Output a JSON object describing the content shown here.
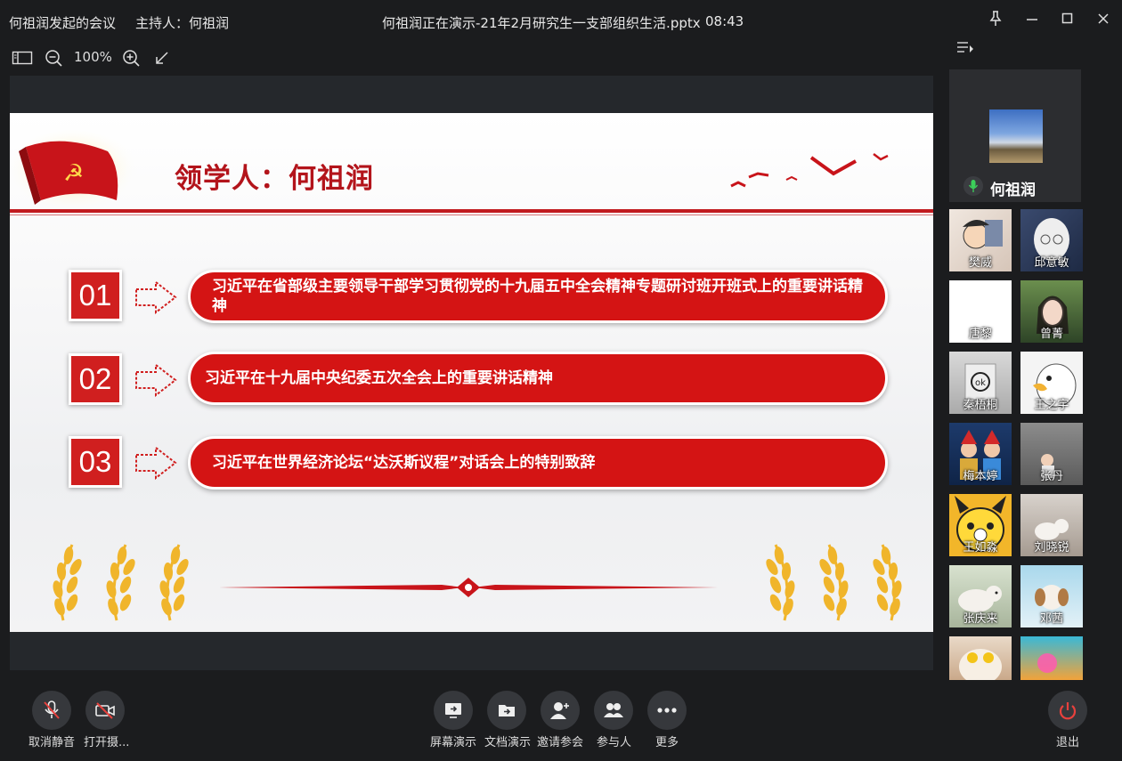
{
  "titlebar": {
    "meeting": "何祖润发起的会议",
    "host": "主持人：何祖润",
    "presenting": "何祖润正在演示-21年2月研究生一支部组织生活.pptx",
    "time": "08:43"
  },
  "toolbar": {
    "zoom": "100%"
  },
  "slide": {
    "title": "领学人：何祖润",
    "items": [
      {
        "num": "01",
        "text": "习近平在省部级主要领导干部学习贯彻党的十九届五中全会精神专题研讨班开班式上的重要讲话精神"
      },
      {
        "num": "02",
        "text": "习近平在十九届中央纪委五次全会上的重要讲话精神"
      },
      {
        "num": "03",
        "text": "习近平在世界经济论坛“达沃斯议程”对话会上的特别致辞"
      }
    ]
  },
  "sidebar": {
    "host_name": "何祖润",
    "participants": [
      "樊威",
      "邱意敏",
      "唐黎",
      "曾菁",
      "秦梧桐",
      "王之宇",
      "梅本婷",
      "张丹",
      "王如淼",
      "刘晓锐",
      "张庆来",
      "邓茜",
      "",
      ""
    ]
  },
  "bottombar": {
    "mute": "取消静音",
    "camera": "打开摄...",
    "screen_share": "屏幕演示",
    "doc_share": "文档演示",
    "invite": "邀请参会",
    "participants": "参与人",
    "more": "更多",
    "exit": "退出"
  },
  "colors": {
    "accent_red": "#d41414",
    "exit_red": "#e8413d",
    "background": "#1b1c1e"
  }
}
